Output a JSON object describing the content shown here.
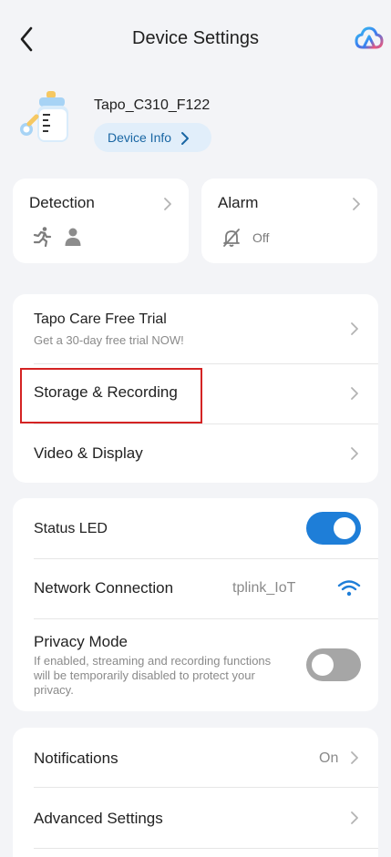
{
  "header": {
    "title": "Device Settings"
  },
  "device": {
    "name": "Tapo_C310_F122",
    "info_button_label": "Device Info"
  },
  "detection": {
    "title": "Detection"
  },
  "alarm": {
    "title": "Alarm",
    "status": "Off"
  },
  "services": {
    "care": {
      "title": "Tapo Care Free Trial",
      "subtitle": "Get a 30-day free trial NOW!"
    },
    "storage": {
      "title": "Storage & Recording"
    },
    "video": {
      "title": "Video & Display"
    }
  },
  "system": {
    "status_led": {
      "label": "Status LED",
      "enabled": true
    },
    "network": {
      "label": "Network Connection",
      "value": "tplink_IoT"
    },
    "privacy": {
      "label": "Privacy Mode",
      "description": "If enabled, streaming and recording functions will be temporarily disabled to protect your privacy.",
      "enabled": false
    }
  },
  "more": {
    "notifications": {
      "label": "Notifications",
      "value": "On"
    },
    "advanced": {
      "label": "Advanced Settings"
    }
  },
  "colors": {
    "accent": "#1e7ed8",
    "highlight": "#d42323",
    "background": "#f3f4f7"
  }
}
